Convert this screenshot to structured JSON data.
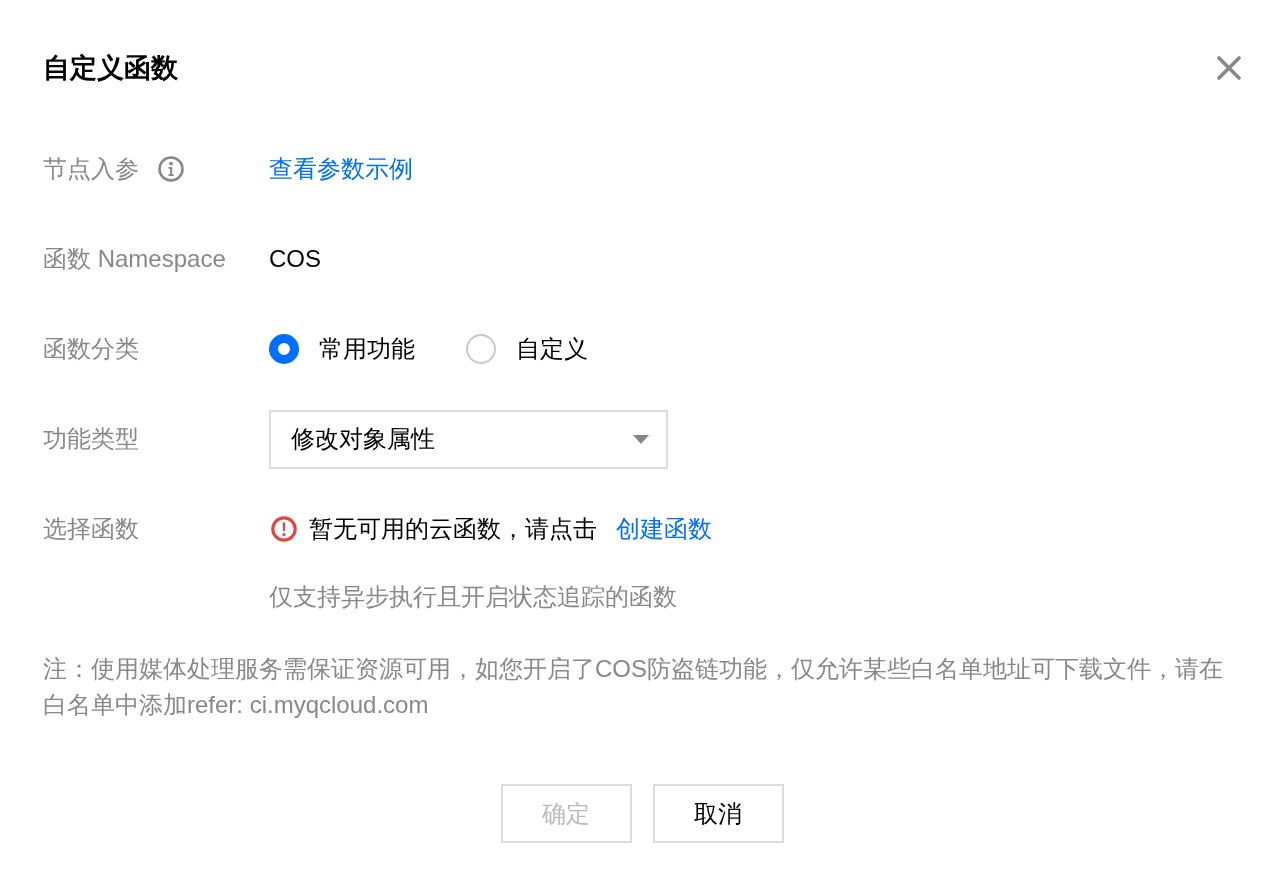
{
  "dialog": {
    "title": "自定义函数"
  },
  "fields": [
    {
      "kind": "link",
      "label": "节点入参",
      "has_tip": true,
      "link": "查看参数示例"
    },
    {
      "kind": "text",
      "label": "函数 Namespace",
      "has_tip": false,
      "value": "COS"
    },
    {
      "kind": "radio",
      "label": "函数分类",
      "has_tip": false,
      "options": [
        {
          "label": "常用功能",
          "selected": true
        },
        {
          "label": "自定义",
          "selected": false
        }
      ]
    },
    {
      "kind": "select",
      "label": "功能类型",
      "has_tip": false,
      "value": "修改对象属性"
    },
    {
      "kind": "notice",
      "label": "选择函数",
      "has_tip": false,
      "message": "暂无可用的云函数，请点击",
      "link": "创建函数",
      "hint": "仅支持异步执行且开启状态追踪的函数"
    }
  ],
  "note": "注：使用媒体处理服务需保证资源可用，如您开启了COS防盗链功能，仅允许某些白名单地址可下载文件，请在白名单中添加refer: ci.myqcloud.com",
  "buttons": [
    {
      "label": "确定",
      "disabled": true
    },
    {
      "label": "取消",
      "disabled": false
    }
  ]
}
